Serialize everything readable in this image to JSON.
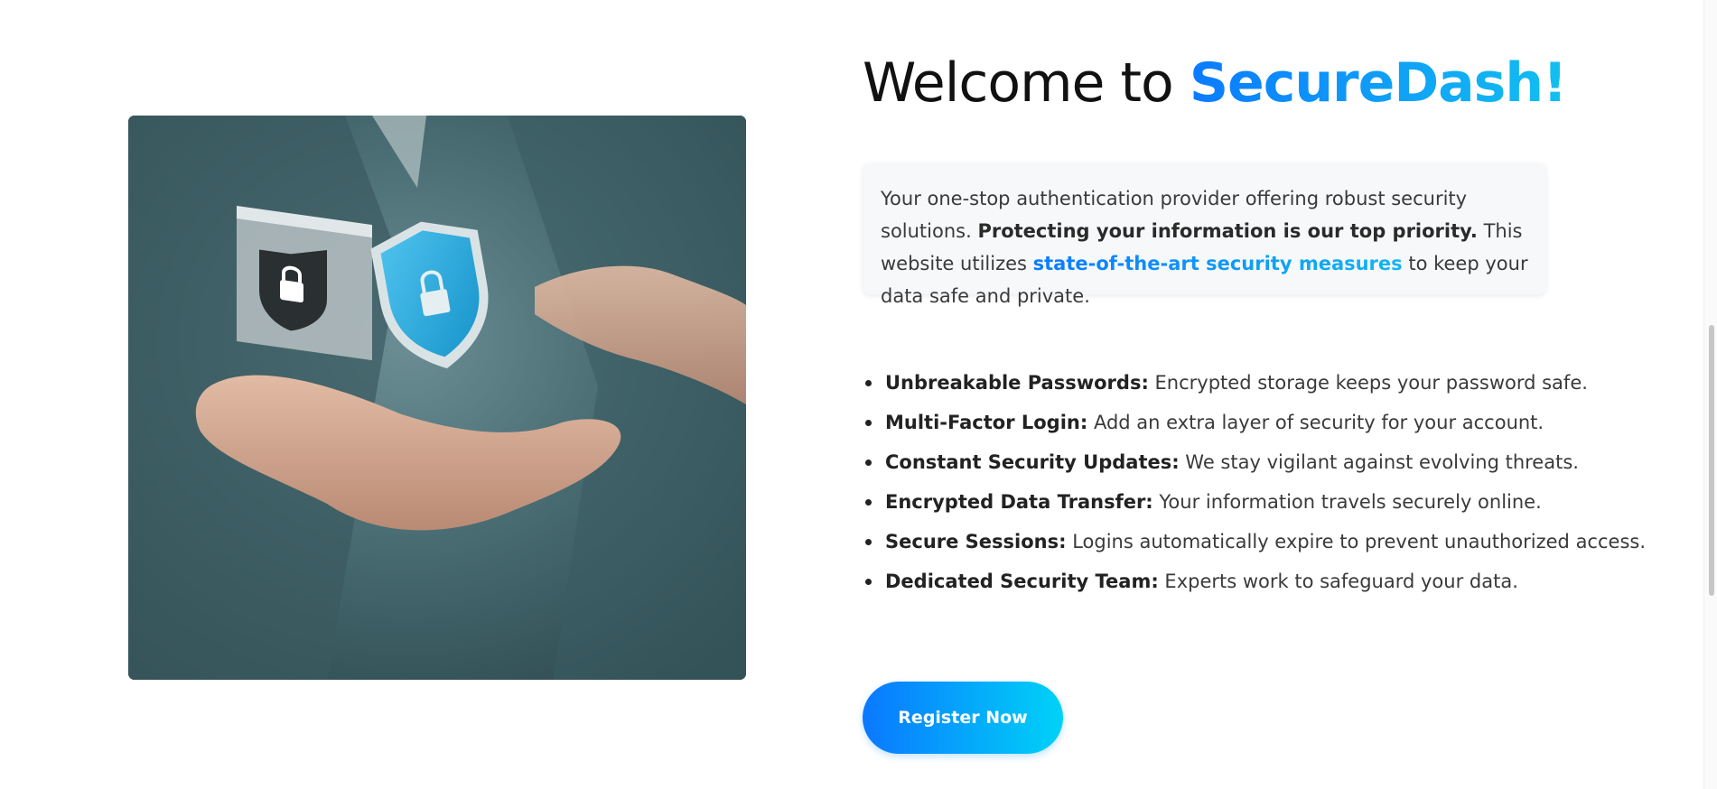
{
  "header": {
    "title_prefix": "Welcome to ",
    "title_brand": "SecureDash!"
  },
  "intro": {
    "text_1": "Your one-stop authentication provider offering robust security solutions. ",
    "bold": "Protecting your information is our top priority.",
    "text_2": " This website utilizes ",
    "link": "state-of-the-art security measures",
    "text_3": " to keep your data safe and private."
  },
  "features": [
    {
      "title": "Unbreakable Passwords:",
      "desc": " Encrypted storage keeps your password safe."
    },
    {
      "title": "Multi-Factor Login:",
      "desc": " Add an extra layer of security for your account."
    },
    {
      "title": "Constant Security Updates:",
      "desc": " We stay vigilant against evolving threats."
    },
    {
      "title": "Encrypted Data Transfer:",
      "desc": " Your information travels securely online."
    },
    {
      "title": "Secure Sessions:",
      "desc": " Logins automatically expire to prevent unauthorized access."
    },
    {
      "title": "Dedicated Security Team:",
      "desc": " Experts work to safeguard your data."
    }
  ],
  "cta": {
    "register_label": "Register Now"
  },
  "colors": {
    "accent_start": "#0b7bff",
    "accent_end": "#00d2f7",
    "card_bg": "#f6f8fa"
  },
  "hero": {
    "icons": [
      "padlock-shield-icon",
      "padlock-shield-icon"
    ]
  }
}
